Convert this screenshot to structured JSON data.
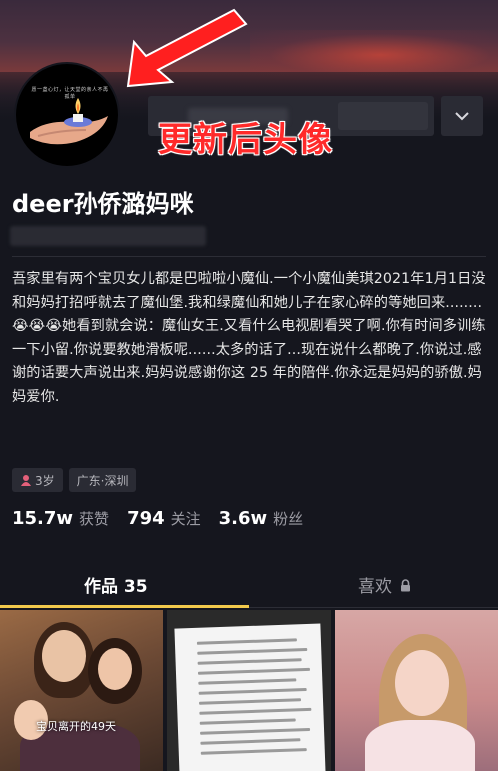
{
  "annotation": {
    "text": "更新后头像"
  },
  "avatar": {
    "caption": "愿一盏心灯，让天堂的亲人不再孤单"
  },
  "profile": {
    "name": "deer孙侨潞妈咪",
    "bio": "吾家里有两个宝贝女儿都是巴啦啦小魔仙.一个小魔仙美琪2021年1月1日没和妈妈打招呼就去了魔仙堡.我和绿魔仙和她儿子在家心碎的等她回来........😭😭😭她看到就会说：魔仙女王.又看什么电视剧看哭了啊.你有时间多训练一下小留.你说要教她滑板呢......太多的话了...现在说什么都晚了.你说过.感谢的话要大声说出来.妈妈说感谢你这 25 年的陪伴.你永远是妈妈的骄傲.妈妈爱你."
  },
  "tags": {
    "age": "3岁",
    "location": "广东·深圳"
  },
  "stats": {
    "likes_num": "15.7w",
    "likes_label": "获赞",
    "following_num": "794",
    "following_label": "关注",
    "followers_num": "3.6w",
    "followers_label": "粉丝"
  },
  "tabs": {
    "works": "作品 35",
    "likes": "喜欢"
  },
  "thumbnails": {
    "first_caption": "宝贝离开的49天"
  },
  "colors": {
    "accent": "#f2c94c",
    "annotation": "#ff2a2a",
    "background": "#15161e"
  },
  "icons": [
    "chevron-down-icon",
    "female-icon",
    "lock-icon",
    "arrow-annotation-icon",
    "candle-icon"
  ]
}
